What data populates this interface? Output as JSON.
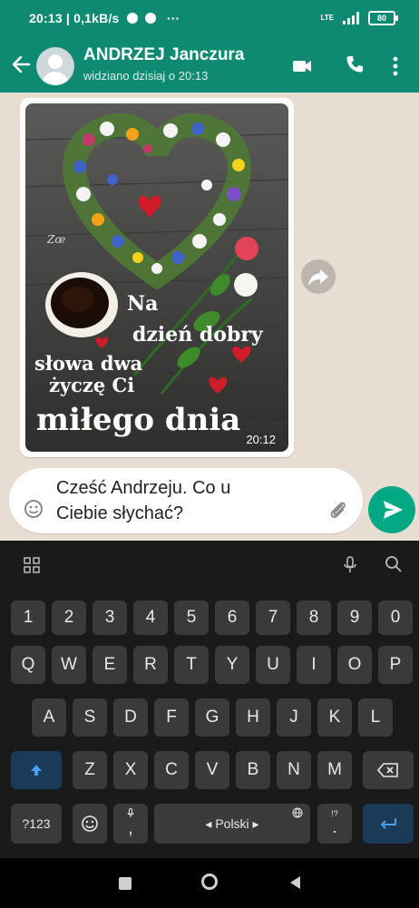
{
  "status_bar": {
    "time_speed": "20:13 | 0,1kB/s",
    "extra_dots": "···",
    "network": "LTE",
    "battery": "80"
  },
  "header": {
    "contact_name": "ANDRZEJ Janczura",
    "last_seen": "widziano dzisiaj o 20:13"
  },
  "message": {
    "image_text": [
      "Na",
      "dzień dobry",
      "słowa dwa",
      "życzę Ci",
      "miłego dnia"
    ],
    "signature": "Zœ",
    "time": "20:12"
  },
  "composer": {
    "text": "Cześć Andrzeju. Co u\nCiebie słychać?"
  },
  "keyboard": {
    "row_numbers": [
      "1",
      "2",
      "3",
      "4",
      "5",
      "6",
      "7",
      "8",
      "9",
      "0"
    ],
    "row1": [
      "Q",
      "W",
      "E",
      "R",
      "T",
      "Y",
      "U",
      "I",
      "O",
      "P"
    ],
    "row2": [
      "A",
      "S",
      "D",
      "F",
      "G",
      "H",
      "J",
      "K",
      "L"
    ],
    "row3": [
      "Z",
      "X",
      "C",
      "V",
      "B",
      "N",
      "M"
    ],
    "symbols_key": "?123",
    "comma_key": ",",
    "period_key": ".",
    "punct_hint": "!?",
    "space_label": "◂ Polski ▸"
  },
  "colors": {
    "header": "#0f8a72",
    "send": "#00a884",
    "keyboard_bg": "#1a1a1a",
    "key": "#3a3a3a",
    "accent_key": "#1b3a57"
  }
}
